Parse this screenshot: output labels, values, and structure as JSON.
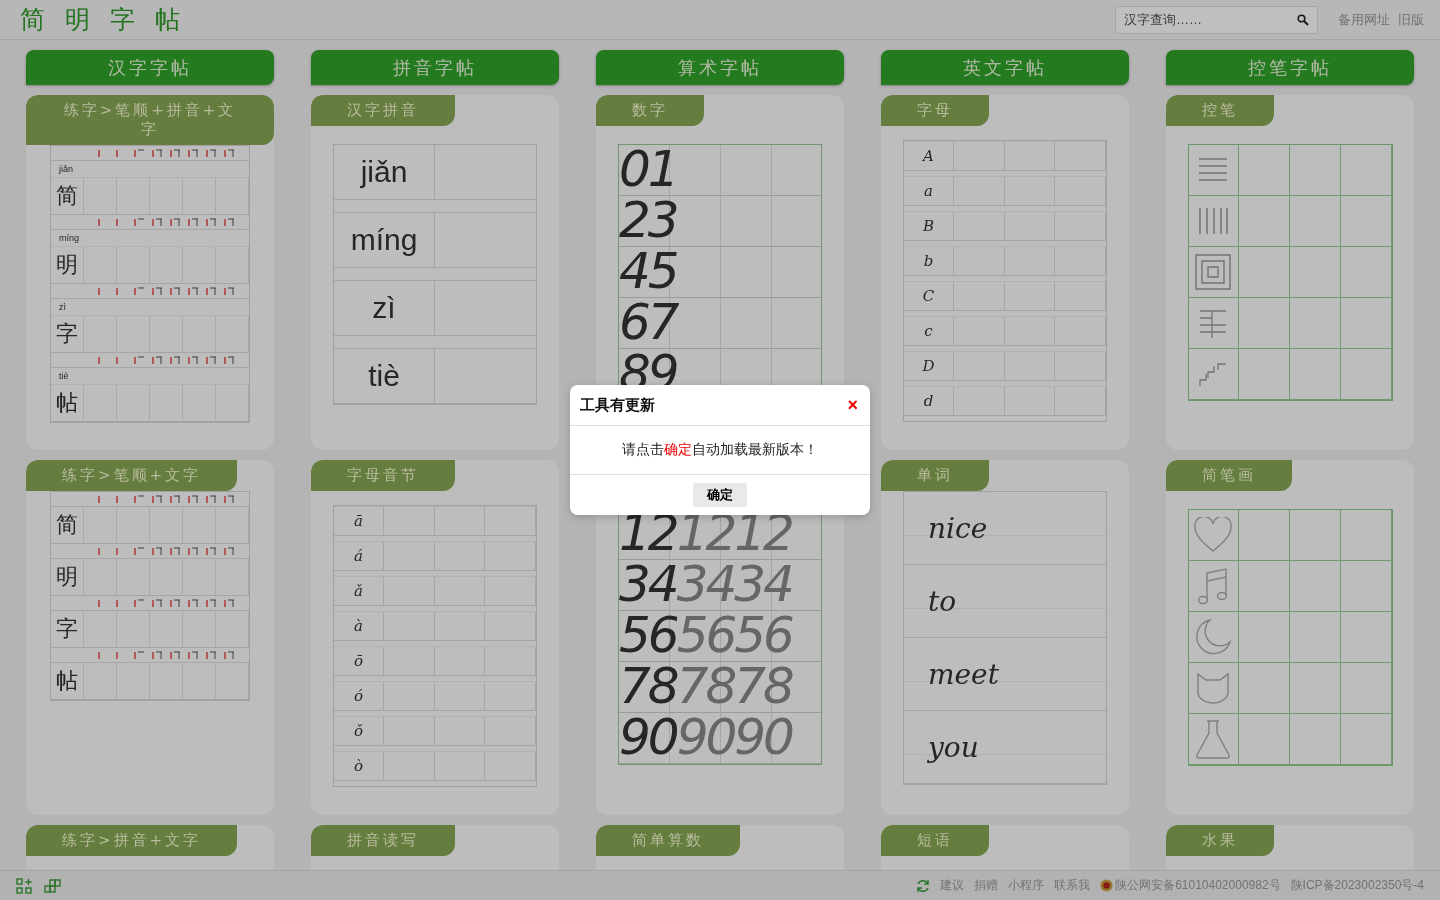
{
  "header": {
    "logo": "简 明 字 帖",
    "search": {
      "placeholder": "汉字查询……"
    },
    "links": [
      "备用网址",
      "旧版"
    ]
  },
  "categories": [
    "汉字字帖",
    "拼音字帖",
    "算术字帖",
    "英文字帖",
    "控笔字帖"
  ],
  "cards": [
    {
      "tab": "练字>笔顺+拼音+文字",
      "kind": "stroke",
      "rows": [
        {
          "pinyin": "jiǎn",
          "char": "简"
        },
        {
          "pinyin": "míng",
          "char": "明"
        },
        {
          "pinyin": "zì",
          "char": "字"
        },
        {
          "pinyin": "tiè",
          "char": "帖"
        }
      ]
    },
    {
      "tab": "汉字拼音",
      "kind": "pinyin",
      "rows": [
        "jiǎn",
        "míng",
        "zì",
        "tiè"
      ]
    },
    {
      "tab": "数字",
      "kind": "digits",
      "rows": [
        {
          "main": "01"
        },
        {
          "main": "23"
        },
        {
          "main": "45"
        },
        {
          "main": "67"
        },
        {
          "main": "89"
        }
      ]
    },
    {
      "tab": "字母",
      "kind": "letters",
      "rows": [
        "A",
        "a",
        "B",
        "b",
        "C",
        "c",
        "D",
        "d"
      ]
    },
    {
      "tab": "控笔",
      "kind": "pen-control"
    },
    {
      "tab": "练字>笔顺+文字",
      "kind": "stroke",
      "rows": [
        {
          "char": "简"
        },
        {
          "char": "明"
        },
        {
          "char": "字"
        },
        {
          "char": "帖"
        }
      ]
    },
    {
      "tab": "字母音节",
      "kind": "letters",
      "rows": [
        "ā",
        "á",
        "ǎ",
        "à",
        "ō",
        "ó",
        "ǒ",
        "ò"
      ]
    },
    {
      "kind": "digits",
      "rows": [
        {
          "main": "12",
          "trace": "1212"
        },
        {
          "main": "34",
          "trace": "3434"
        },
        {
          "main": "56",
          "trace": "5656"
        },
        {
          "main": "78",
          "trace": "7878"
        },
        {
          "main": "90",
          "trace": "9090"
        }
      ]
    },
    {
      "tab": "单词",
      "kind": "words",
      "rows": [
        "nice",
        "to",
        "meet",
        "you"
      ]
    },
    {
      "tab": "简笔画",
      "kind": "sketch"
    },
    {
      "tab": "练字>拼音+文字",
      "kind": "none"
    },
    {
      "tab": "拼音读写",
      "kind": "none"
    },
    {
      "tab": "简单算数",
      "kind": "none"
    },
    {
      "tab": "短语",
      "kind": "none"
    },
    {
      "tab": "水果",
      "kind": "none"
    }
  ],
  "footer": {
    "links": [
      "建议",
      "捐赠",
      "小程序",
      "联系我"
    ],
    "police_record": "陕公网安备61010402000982号",
    "icp": "陕ICP备2023002350号-4"
  },
  "dialog": {
    "title": "工具有更新",
    "close": "×",
    "message_before": "请点击",
    "message_highlight": "确定",
    "message_after": "自动加载最新版本！",
    "button": "确定"
  }
}
